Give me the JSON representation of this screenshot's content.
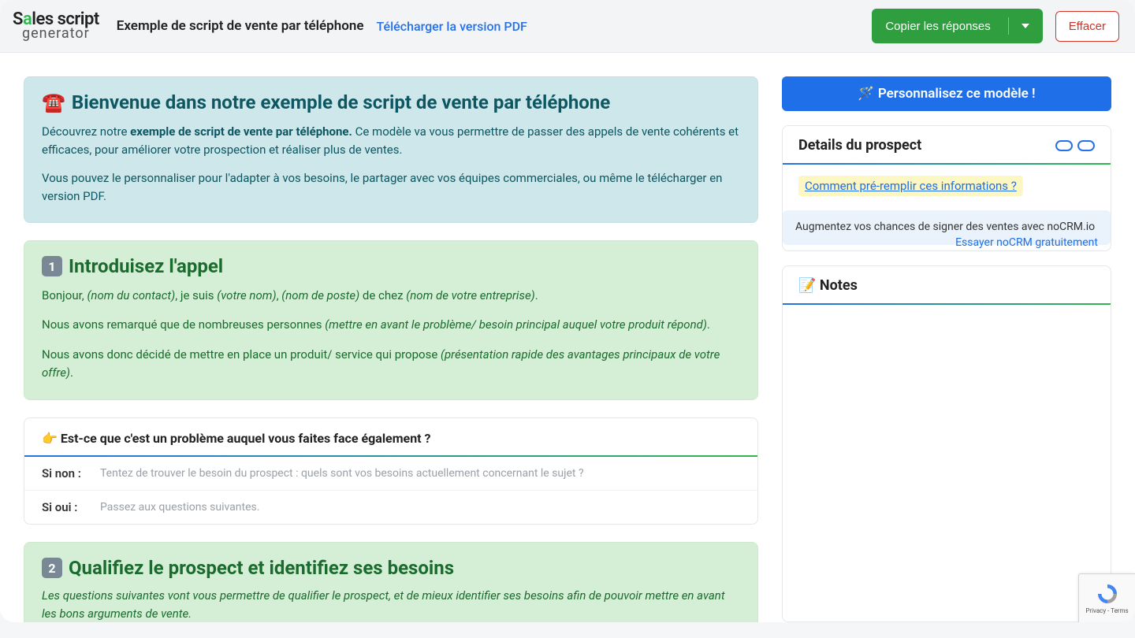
{
  "header": {
    "logo_top_pre": "S",
    "logo_top_accent": "a",
    "logo_top_post": "les script",
    "logo_bottom": "generator",
    "title": "Exemple de script de vente par téléphone",
    "pdf_link": "Télécharger la version PDF",
    "copy_button": "Copier les réponses",
    "clear_button": "Effacer"
  },
  "welcome": {
    "icon": "☎️",
    "title": "Bienvenue dans notre exemple de script de vente par téléphone",
    "p1_pre": "Découvrez notre ",
    "p1_strong": "exemple de script de vente par téléphone.",
    "p1_post": " Ce modèle va vous permettre de passer des appels de vente cohérents et efficaces, pour améliorer votre prospection et réaliser plus de ventes.",
    "p2": "Vous pouvez le personnaliser pour l'adapter à vos besoins, le partager avec vos équipes commerciales, ou même le télécharger en version PDF."
  },
  "intro": {
    "badge": "1",
    "title": "Introduisez l'appel",
    "line1_a": "Bonjour, ",
    "line1_b": "(nom du contact)",
    "line1_c": ", je suis ",
    "line1_d": "(votre nom)",
    "line1_e": ", ",
    "line1_f": "(nom de poste)",
    "line1_g": " de chez ",
    "line1_h": "(nom de votre entreprise)",
    "line1_i": ".",
    "line2_a": "Nous avons remarqué que de nombreuses personnes ",
    "line2_b": "(mettre en avant le problème/ besoin principal auquel votre produit répond)",
    "line2_c": ".",
    "line3_a": "Nous avons donc décidé de mettre en place un produit/ service qui propose ",
    "line3_b": "(présentation rapide des avantages principaux de votre offre)",
    "line3_c": "."
  },
  "question": {
    "icon": "👉",
    "title": "Est-ce que c'est un problème auquel vous faites face également ?",
    "row1_label": "Si non :",
    "row1_placeholder": "Tentez de trouver le besoin du prospect : quels sont vos besoins actuellement concernant le sujet ?",
    "row2_label": "Si oui :",
    "row2_placeholder": "Passez aux questions suivantes."
  },
  "qualify": {
    "badge": "2",
    "title": "Qualifiez le prospect et identifiez ses besoins",
    "desc": "Les questions suivantes vont vous permettre de qualifier le prospect, et de mieux identifier ses besoins afin de pouvoir mettre en avant les bons arguments de vente."
  },
  "side": {
    "personalize_icon": "🪄",
    "personalize": "Personnalisez ce modèle !",
    "details_title": "Details du prospect",
    "prefill_link": "Comment pré-remplir ces informations ?",
    "promo_text": "Augmentez vos chances de signer des ventes avec noCRM.io",
    "promo_link": "Essayer noCRM gratuitement",
    "notes_icon": "📝",
    "notes_title": "Notes"
  },
  "recaptcha": {
    "label": "Privacy - Terms"
  }
}
